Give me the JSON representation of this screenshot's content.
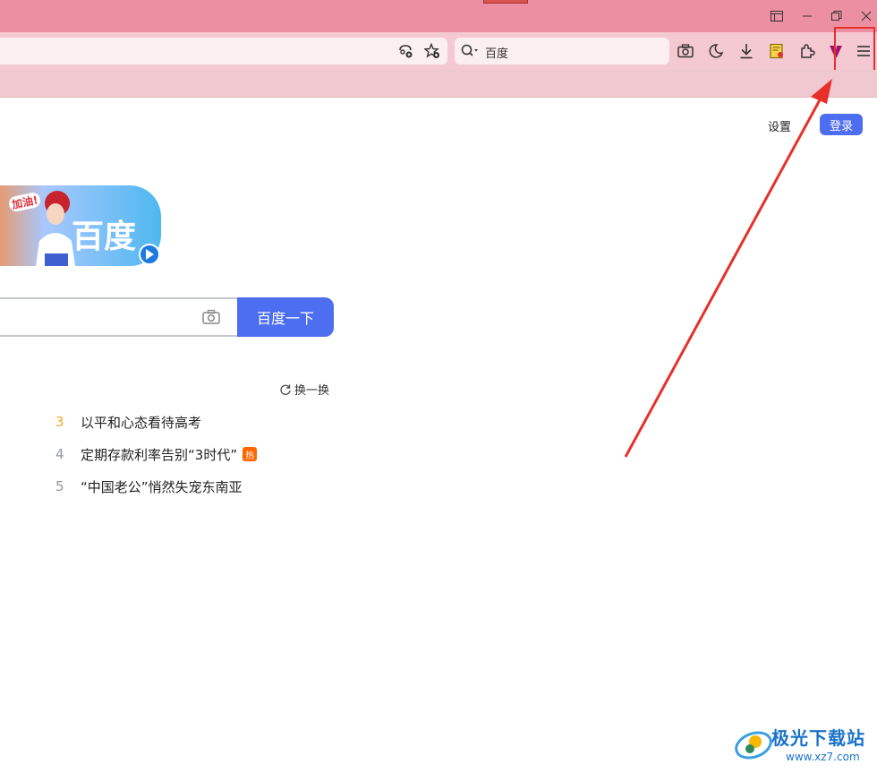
{
  "window": {
    "controls": [
      "sidebar-icon",
      "minimize-icon",
      "restore-icon",
      "close-icon"
    ]
  },
  "toolbar": {
    "url_icons": [
      "translate-icon",
      "star-add-icon"
    ],
    "search_label": "百度",
    "right_icons": [
      "camera-icon",
      "night-mode-icon",
      "download-icon",
      "notes-icon",
      "extensions-icon",
      "v-icon",
      "menu-icon"
    ]
  },
  "page": {
    "settings_label": "设置",
    "login_label": "登录",
    "logo_text": "百度",
    "logo_badge": "加油!",
    "search_button_label": "百度一下",
    "refresh_label": "换一换",
    "hot_list": [
      {
        "num": "3",
        "text": "以平和心态看待高考",
        "badge": ""
      },
      {
        "num": "4",
        "text": "定期存款利率告别“3时代”",
        "badge": "热"
      },
      {
        "num": "5",
        "text": "“中国老公”悄然失宠东南亚",
        "badge": ""
      }
    ]
  },
  "annotation": {
    "color": "#e8302b"
  },
  "watermark": {
    "brand": "极光下载站",
    "url": "www.xz7.com"
  },
  "colors": {
    "titlebar": "#ec8fa3",
    "baidu_blue": "#4e6ef2"
  }
}
